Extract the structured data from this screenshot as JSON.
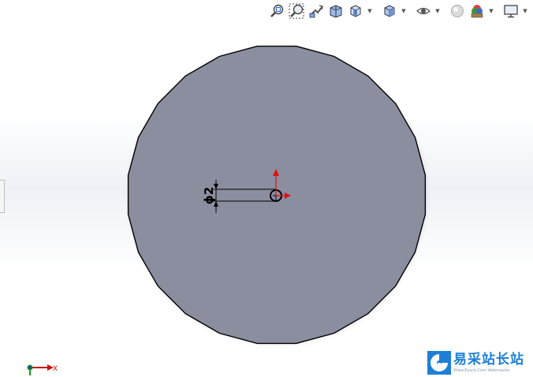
{
  "toolbar": {
    "buttons": [
      {
        "name": "zoom-to-fit",
        "icon": "zoom-to-fit-icon"
      },
      {
        "name": "zoom-to-area",
        "icon": "zoom-to-area-icon"
      },
      {
        "name": "previous-view",
        "icon": "previous-view-icon"
      },
      {
        "name": "section-view",
        "icon": "section-view-icon"
      },
      {
        "name": "view-orientation",
        "icon": "view-orientation-icon"
      },
      {
        "name": "display-style",
        "icon": "display-style-icon"
      },
      {
        "name": "hide-show-items",
        "icon": "eye-icon"
      },
      {
        "name": "edit-appearance",
        "icon": "appearance-icon"
      },
      {
        "name": "apply-scene",
        "icon": "scene-icon"
      },
      {
        "name": "view-settings",
        "icon": "monitor-icon"
      }
    ]
  },
  "sketch": {
    "dimension_label": "ϕ2",
    "plane_color": "#8a8e9f",
    "edge_color": "#000000",
    "axis_color": "#e01010"
  },
  "triad": {
    "x_label": "X",
    "x_color": "#cc1111",
    "y_color": "#1a9a1a",
    "z_color": "#1a3acc"
  },
  "watermark": {
    "title": "易采站长站",
    "subtitle": "Www.Easck.Com Webmaster",
    "brand_color": "#1d7fd6"
  }
}
